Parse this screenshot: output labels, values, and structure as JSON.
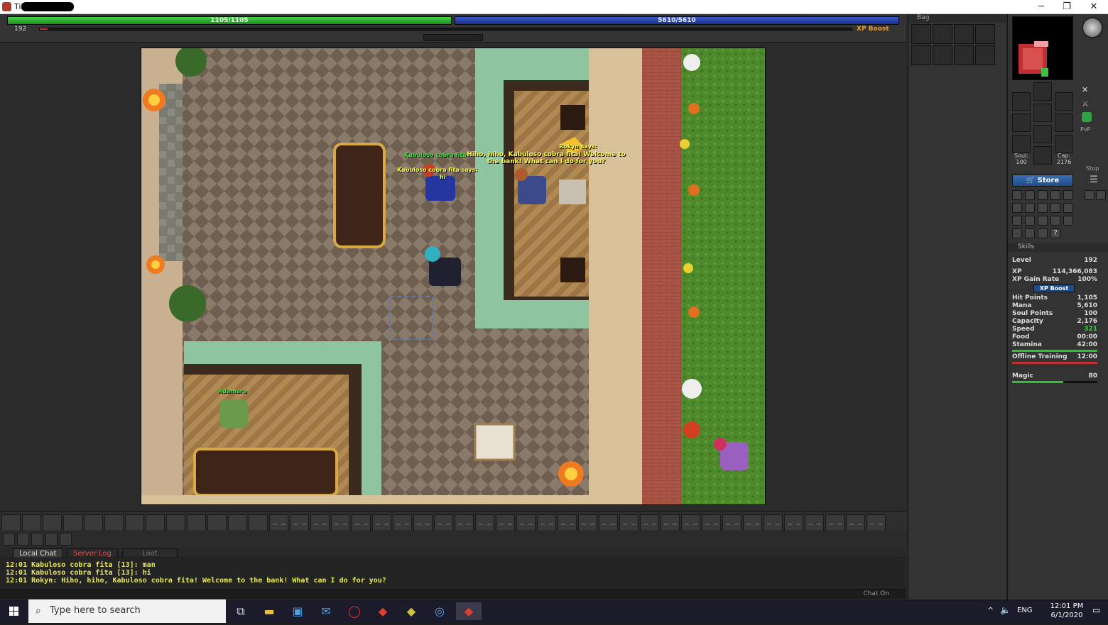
{
  "window": {
    "title": "Tibia",
    "min": "─",
    "max": "❐",
    "close": "✕"
  },
  "stats_bar": {
    "hp": "1105/1105",
    "mana": "5610/5610",
    "level": "192",
    "level_progress": 0.01,
    "xp_boost": "XP Boost"
  },
  "game": {
    "npc_name": "Rokyn says:",
    "npc_speech": "Hiho, hiho, Kabuloso cobra fita! Welcome to the bank! What can I do for you?",
    "player_name": "Kabuloso cobra fita",
    "player_says_label": "Kabuloso cobra fita says:",
    "player_speech": "hi",
    "other_name": "Adamara"
  },
  "chat": {
    "tabs": [
      "Local Chat",
      "Server Log",
      "Loot"
    ],
    "active_tab": "Local Chat",
    "lines": [
      "12:01 Kabuloso cobra fita [13]: man",
      "12:01 Kabuloso cobra fita [13]: hi",
      "12:01 Rokyn: Hiho, hiho, Kabuloso cobra fita! Welcome to the bank! What can I do for you?"
    ],
    "chat_on": "Chat On"
  },
  "bag": {
    "title": "Bag"
  },
  "equipment": {
    "soul_label": "Soul:",
    "soul": "100",
    "cap_label": "Cap:",
    "cap": "2176",
    "stop": "Stop",
    "store": "Store",
    "pvp": "PvP"
  },
  "skills": {
    "title": "Skills",
    "level_label": "Level",
    "level": "192",
    "xp_label": "XP",
    "xp": "114,366,083",
    "xp_rate_label": "XP Gain Rate",
    "xp_rate": "100%",
    "xp_boost": "XP Boost",
    "rows": [
      {
        "label": "Hit Points",
        "value": "1,105"
      },
      {
        "label": "Mana",
        "value": "5,610"
      },
      {
        "label": "Soul Points",
        "value": "100"
      },
      {
        "label": "Capacity",
        "value": "2,176"
      },
      {
        "label": "Speed",
        "value": "321"
      },
      {
        "label": "Food",
        "value": "00:00"
      },
      {
        "label": "Stamina",
        "value": "42:00"
      }
    ],
    "offline_label": "Offline Training",
    "offline": "12:00",
    "magic_label": "Magic",
    "magic": "80",
    "stamina_fill": 1.0,
    "magic_fill": 0.6
  },
  "taskbar": {
    "search_placeholder": "Type here to search",
    "time": "12:01 PM",
    "date": "6/1/2020",
    "lang": "ENG"
  },
  "colors": {
    "hp": "#2fb02f",
    "mana": "#2b45b0",
    "chat_text": "#e8e85a",
    "speed": "#3cd23c"
  }
}
